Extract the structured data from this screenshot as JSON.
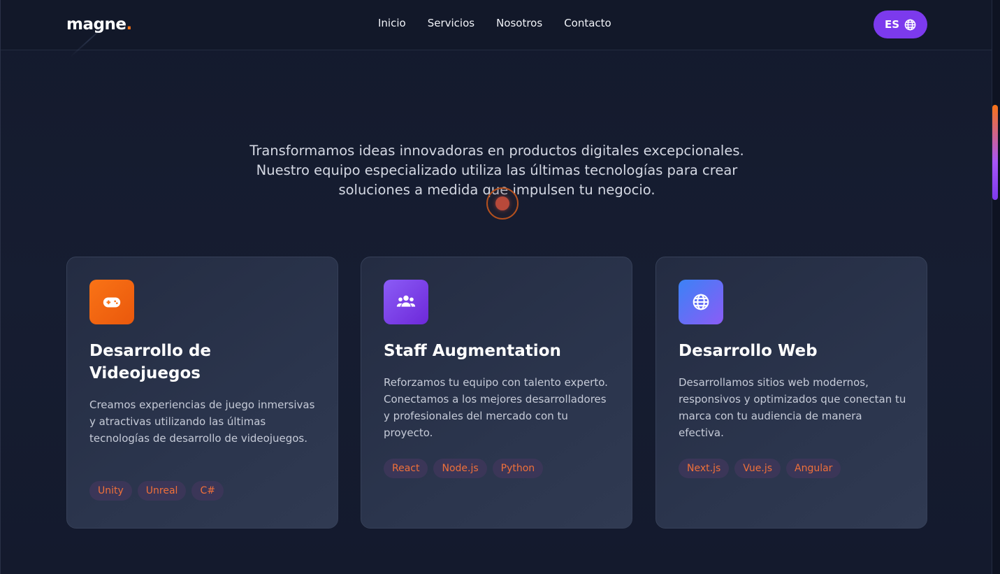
{
  "header": {
    "logo": "magne",
    "logo_dot": ".",
    "nav": [
      {
        "label": "Inicio"
      },
      {
        "label": "Servicios"
      },
      {
        "label": "Nosotros"
      },
      {
        "label": "Contacto"
      }
    ],
    "language_button": {
      "label": "ES",
      "icon": "globe-icon"
    }
  },
  "intro": {
    "text": "Transformamos ideas innovadoras en productos digitales excepcionales. Nuestro equipo especializado utiliza las últimas tecnologías para crear soluciones a medida que impulsen tu negocio."
  },
  "services": [
    {
      "icon": "gamepad-icon",
      "title": "Desarrollo de Videojuegos",
      "description": "Creamos experiencias de juego inmersivas y atractivas utilizando las últimas tecnologías de desarrollo de videojuegos.",
      "tags": [
        "Unity",
        "Unreal",
        "C#"
      ]
    },
    {
      "icon": "users-icon",
      "title": "Staff Augmentation",
      "description": "Reforzamos tu equipo con talento experto. Conectamos a los mejores desarrolladores y profesionales del mercado con tu proyecto.",
      "tags": [
        "React",
        "Node.js",
        "Python"
      ]
    },
    {
      "icon": "globe-icon",
      "title": "Desarrollo Web",
      "description": "Desarrollamos sitios web modernos, responsivos y optimizados que conectan tu marca con tu audiencia de manera efectiva.",
      "tags": [
        "Next.js",
        "Vue.js",
        "Angular"
      ]
    }
  ],
  "colors": {
    "accent_orange": "#f97316",
    "accent_purple": "#7c3aed",
    "background": "#141a2d",
    "card": "#2b354d",
    "tag_bg": "#3b3658",
    "tag_text": "#f0703a"
  }
}
